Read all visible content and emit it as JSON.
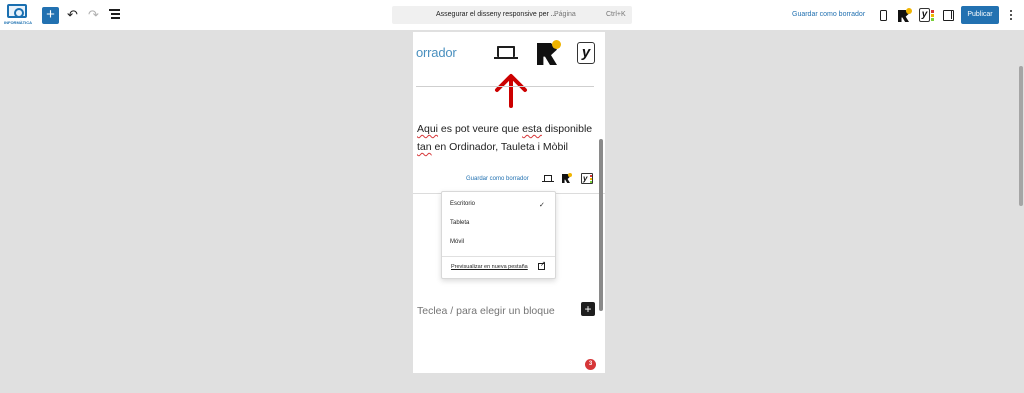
{
  "header": {
    "logo_label": "INFORMÀTICA",
    "add_icon": "plus-icon",
    "undo_icon": "undo-icon",
    "redo_icon": "redo-icon",
    "list_view_icon": "list-view-icon",
    "command": {
      "title": "Assegurar el disseny responsive per ...",
      "separator": "·",
      "type": "Página",
      "shortcut": "Ctrl+K"
    },
    "save_draft": "Guardar como borrador",
    "publish": "Publicar"
  },
  "canvas": {
    "big_borrador": "orrador",
    "paragraph_word1": "Aqui",
    "paragraph_rest1": " es pot veure que ",
    "paragraph_word2": "esta",
    "paragraph_rest2": " disponible",
    "paragraph_word3": "tan",
    "paragraph_rest3": " en Ordinador, Tauleta i Mòbil",
    "mini_save_draft": "Guardar como borrador",
    "menu": {
      "items": [
        "Escritorio",
        "Tableta",
        "Móvil"
      ],
      "selected": "Escritorio",
      "check": "✓",
      "preview": "Previsualizar en nueva pestaña"
    },
    "placeholder": "Teclea / para elegir un bloque",
    "inserter": "+",
    "badge": "3"
  },
  "colors": {
    "accent": "#2271b1",
    "arrow": "#cc0000",
    "badge": "#d63638",
    "yoast_bars": [
      "#d63638",
      "#f0b400",
      "#7ad03a"
    ]
  }
}
